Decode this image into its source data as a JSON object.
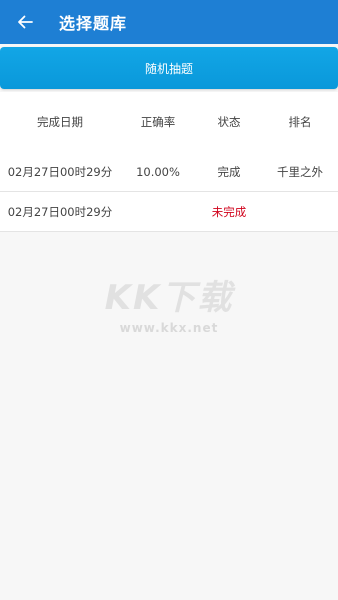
{
  "app_bar": {
    "title": "选择题库",
    "back_icon": "arrow-left-icon",
    "background": "#1e7fd4"
  },
  "random_button": {
    "label": "随机抽题",
    "color": "#0a98da"
  },
  "table": {
    "headers": [
      "完成日期",
      "正确率",
      "状态",
      "排名"
    ],
    "rows": [
      {
        "date": "02月27日00时29分",
        "accuracy": "10.00%",
        "status": "完成",
        "rank": "千里之外"
      },
      {
        "date": "02月27日00时29分",
        "accuracy": "",
        "status": "未完成",
        "rank": ""
      }
    ],
    "incomplete_color": "#d0021b"
  },
  "watermark": {
    "logo": "KK下载",
    "url": "www.kkx.net"
  }
}
